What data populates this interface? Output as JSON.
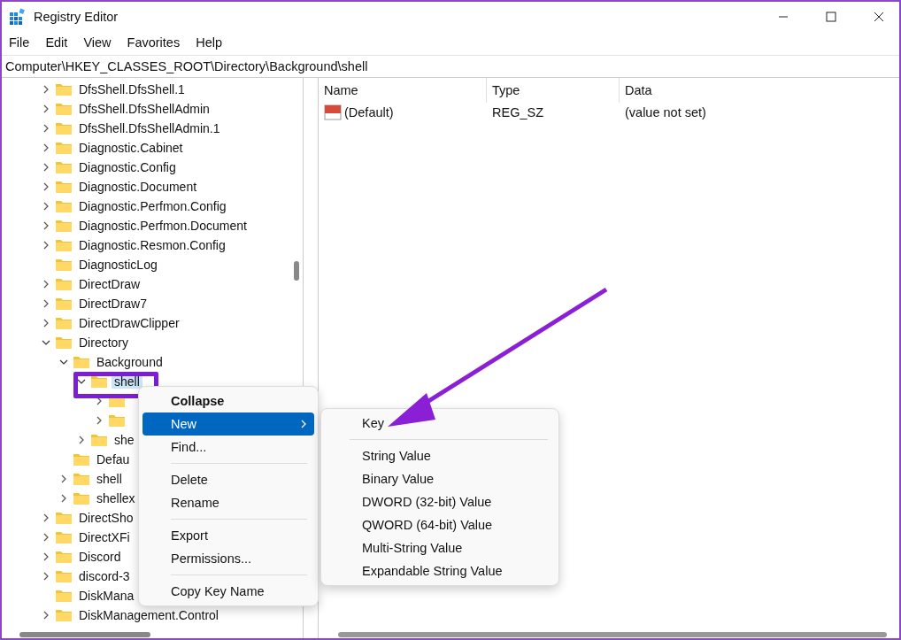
{
  "window": {
    "title": "Registry Editor"
  },
  "menu_bar": [
    "File",
    "Edit",
    "View",
    "Favorites",
    "Help"
  ],
  "address": "Computer\\HKEY_CLASSES_ROOT\\Directory\\Background\\shell",
  "tree": [
    {
      "label": "DfsShell.DfsShell.1",
      "kind": "node",
      "expanded": false,
      "selected": false
    },
    {
      "label": "DfsShell.DfsShellAdmin",
      "kind": "node",
      "expanded": false,
      "selected": false
    },
    {
      "label": "DfsShell.DfsShellAdmin.1",
      "kind": "node",
      "expanded": false,
      "selected": false
    },
    {
      "label": "Diagnostic.Cabinet",
      "kind": "node",
      "expanded": false,
      "selected": false
    },
    {
      "label": "Diagnostic.Config",
      "kind": "node",
      "expanded": false,
      "selected": false
    },
    {
      "label": "Diagnostic.Document",
      "kind": "node",
      "expanded": false,
      "selected": false
    },
    {
      "label": "Diagnostic.Perfmon.Config",
      "kind": "node",
      "expanded": false,
      "selected": false
    },
    {
      "label": "Diagnostic.Perfmon.Document",
      "kind": "node",
      "expanded": false,
      "selected": false
    },
    {
      "label": "Diagnostic.Resmon.Config",
      "kind": "node",
      "expanded": false,
      "selected": false
    },
    {
      "label": "DiagnosticLog",
      "kind": "leaf",
      "selected": false
    },
    {
      "label": "DirectDraw",
      "kind": "node",
      "expanded": false,
      "selected": false
    },
    {
      "label": "DirectDraw7",
      "kind": "node",
      "expanded": false,
      "selected": false
    },
    {
      "label": "DirectDrawClipper",
      "kind": "node",
      "expanded": false,
      "selected": false
    },
    {
      "label": "Directory",
      "kind": "node",
      "expanded": true,
      "selected": false,
      "children": [
        {
          "label": "Background",
          "kind": "node",
          "expanded": true,
          "selected": false,
          "children": [
            {
              "label": "shell",
              "kind": "node",
              "expanded": true,
              "selected": true,
              "children": [
                {
                  "kind": "node",
                  "expanded": false
                },
                {
                  "kind": "node",
                  "expanded": false
                }
              ]
            },
            {
              "label": "she",
              "kind": "node",
              "expanded": false,
              "selected": false
            }
          ]
        },
        {
          "label": "Defau",
          "kind": "leaf",
          "selected": false
        },
        {
          "label": "shell",
          "kind": "node",
          "expanded": false,
          "selected": false
        },
        {
          "label": "shellex",
          "kind": "node",
          "expanded": false,
          "selected": false
        }
      ]
    },
    {
      "label": "DirectSho",
      "kind": "node",
      "expanded": false,
      "selected": false
    },
    {
      "label": "DirectXFi",
      "kind": "node",
      "expanded": false,
      "selected": false
    },
    {
      "label": "Discord",
      "kind": "node",
      "expanded": false,
      "selected": false
    },
    {
      "label": "discord-3",
      "kind": "node",
      "expanded": false,
      "selected": false
    },
    {
      "label": "DiskMana",
      "kind": "leaf",
      "selected": false
    },
    {
      "label": "DiskManagement.Control",
      "kind": "node",
      "expanded": false,
      "selected": false
    }
  ],
  "values": {
    "columns": [
      "Name",
      "Type",
      "Data"
    ],
    "rows": [
      {
        "name": "(Default)",
        "type": "REG_SZ",
        "data": "(value not set)"
      }
    ]
  },
  "context_menu": [
    {
      "kind": "item",
      "label": "Collapse",
      "default": true,
      "selected": false,
      "submenu": false
    },
    {
      "kind": "item",
      "label": "New",
      "default": false,
      "selected": true,
      "submenu": true
    },
    {
      "kind": "item",
      "label": "Find...",
      "default": false,
      "selected": false,
      "submenu": false
    },
    {
      "kind": "separator"
    },
    {
      "kind": "item",
      "label": "Delete",
      "default": false,
      "selected": false,
      "submenu": false
    },
    {
      "kind": "item",
      "label": "Rename",
      "default": false,
      "selected": false,
      "submenu": false
    },
    {
      "kind": "separator"
    },
    {
      "kind": "item",
      "label": "Export",
      "default": false,
      "selected": false,
      "submenu": false
    },
    {
      "kind": "item",
      "label": "Permissions...",
      "default": false,
      "selected": false,
      "submenu": false
    },
    {
      "kind": "separator"
    },
    {
      "kind": "item",
      "label": "Copy Key Name",
      "default": false,
      "selected": false,
      "submenu": false
    }
  ],
  "submenu": [
    {
      "kind": "item",
      "label": "Key"
    },
    {
      "kind": "separator"
    },
    {
      "kind": "item",
      "label": "String Value"
    },
    {
      "kind": "item",
      "label": "Binary Value"
    },
    {
      "kind": "item",
      "label": "DWORD (32-bit) Value"
    },
    {
      "kind": "item",
      "label": "QWORD (64-bit) Value"
    },
    {
      "kind": "item",
      "label": "Multi-String Value"
    },
    {
      "kind": "item",
      "label": "Expandable String Value"
    }
  ]
}
